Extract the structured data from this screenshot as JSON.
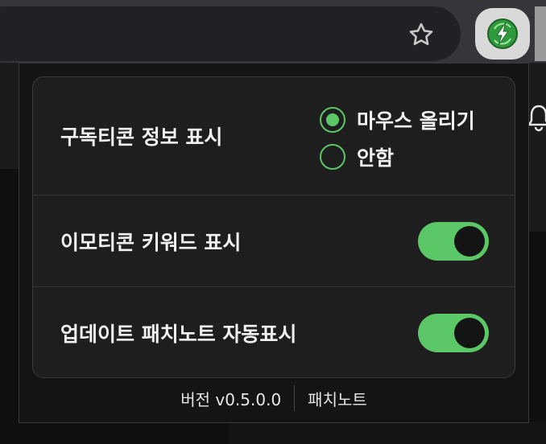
{
  "popup": {
    "rows": [
      {
        "label": "구독티콘 정보 표시",
        "control": "radio",
        "options": [
          {
            "label": "마우스 올리기",
            "checked": true
          },
          {
            "label": "안함",
            "checked": false
          }
        ]
      },
      {
        "label": "이모티콘 키워드 표시",
        "control": "toggle",
        "on": true
      },
      {
        "label": "업데이트 패치노트 자동표시",
        "control": "toggle",
        "on": true
      }
    ],
    "footer": {
      "version": "버전 v0.5.0.0",
      "patch_notes_link": "패치노트"
    }
  },
  "icons": {
    "bookmark": "star-icon",
    "extension": "lightning-bolt-icon",
    "page_behind": [
      "bell-icon"
    ]
  },
  "colors": {
    "accent": "#5cc766",
    "popup_bg": "#141414",
    "card_bg": "#1e1e1e"
  }
}
